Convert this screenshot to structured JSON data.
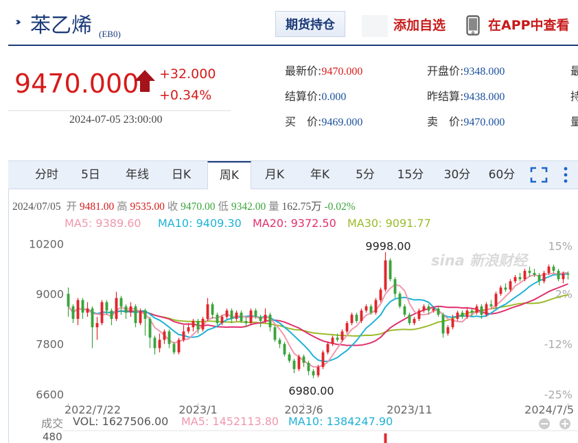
{
  "header": {
    "name": "苯乙烯",
    "code": "(EB0)",
    "holdings_button": "期货持仓",
    "add_watchlist": "添加自选",
    "view_in_app": "在APP中查看"
  },
  "quote": {
    "price": "9470.000",
    "change": "+32.000",
    "change_pct": "+0.34%",
    "datetime": "2024-07-05 23:00:00",
    "fields": [
      {
        "label": "最新价:",
        "value": "9470.000",
        "color": "#d61a1a"
      },
      {
        "label": "开盘价:",
        "value": "9348.000",
        "color": "#1a4f9c"
      },
      {
        "label": "结算价:",
        "value": "0.000",
        "color": "#1a4f9c"
      },
      {
        "label": "昨结算:",
        "value": "9438.000",
        "color": "#1a4f9c"
      },
      {
        "label": "买　价:",
        "value": "9469.000",
        "color": "#1a4f9c"
      },
      {
        "label": "卖　价:",
        "value": "9470.000",
        "color": "#1a4f9c"
      }
    ],
    "cut_labels": [
      "最",
      "持",
      "量"
    ]
  },
  "tabs": {
    "items": [
      "分时",
      "5日",
      "年线",
      "日K",
      "周K",
      "月K",
      "年K",
      "5分",
      "15分",
      "30分",
      "60分"
    ],
    "active_index": 4
  },
  "ohlc_bar": {
    "date": "2024/07/05",
    "open_label": "开",
    "open": "9481.00",
    "high_label": "高",
    "high": "9535.00",
    "close_label": "收",
    "close": "9470.00",
    "low_label": "低",
    "low": "9342.00",
    "vol_label": "量",
    "vol": "162.75万",
    "pct": "-0.02%"
  },
  "ma_legend": {
    "ma5": "MA5: 9389.60",
    "ma10": "MA10: 9409.30",
    "ma20": "MA20: 9372.50",
    "ma30": "MA30: 9091.77"
  },
  "volume_legend": {
    "title": "成交",
    "vol": "VOL: 1627506.00",
    "ma5": "MA5: 1452113.80",
    "ma10": "MA10: 1384247.90",
    "axis_top": "480"
  },
  "watermark": "sina 新浪财经",
  "colors": {
    "up": "#e0262c",
    "down": "#3aa43a",
    "ma5": "#f197ad",
    "ma10": "#1fb1d6",
    "ma20": "#e0306e",
    "ma30": "#9bbb2b",
    "brand": "#1b3a79"
  },
  "chart_data": {
    "type": "candlestick",
    "ylim": [
      6350,
      10500
    ],
    "y_ticks": [
      "10200",
      "9000",
      "7800",
      "6600"
    ],
    "y_tick_values": [
      10200,
      9000,
      7800,
      6600
    ],
    "pct_ticks": [
      "15%",
      "2%",
      "-12%",
      "-25%"
    ],
    "pct_tick_values": [
      10150,
      9000,
      7800,
      6600
    ],
    "x_labels": [
      "2022/7/22",
      "2023/1",
      "2023/6",
      "2023/11",
      "2024/7/5"
    ],
    "x_label_index": [
      0,
      27,
      49,
      71,
      104
    ],
    "annotations": [
      {
        "text": "9998.00",
        "index": 66,
        "value": 9998
      },
      {
        "text": "6980.00",
        "index": 51,
        "value": 6980
      }
    ],
    "candles": [
      [
        9000,
        8700,
        9150,
        8450
      ],
      [
        8700,
        8400,
        8750,
        8300
      ],
      [
        8400,
        8850,
        8900,
        8250
      ],
      [
        8850,
        8550,
        8900,
        8400
      ],
      [
        8550,
        8650,
        8800,
        8450
      ],
      [
        8650,
        8200,
        8700,
        7700
      ],
      [
        8200,
        8300,
        8450,
        7900
      ],
      [
        8300,
        8800,
        8850,
        8250
      ],
      [
        8800,
        8600,
        8850,
        8500
      ],
      [
        8600,
        8400,
        8650,
        8250
      ],
      [
        8400,
        8900,
        9050,
        8350
      ],
      [
        8900,
        8700,
        8950,
        8500
      ],
      [
        8700,
        8550,
        8750,
        8400
      ],
      [
        8550,
        8700,
        8800,
        8450
      ],
      [
        8700,
        8300,
        8750,
        8200
      ],
      [
        8300,
        8600,
        8650,
        8250
      ],
      [
        8600,
        8400,
        8650,
        8000
      ],
      [
        8400,
        7950,
        8450,
        7700
      ],
      [
        7950,
        7700,
        8000,
        7550
      ],
      [
        7700,
        7900,
        8050,
        7600
      ],
      [
        7900,
        8100,
        8150,
        7800
      ],
      [
        8100,
        7800,
        8150,
        7700
      ],
      [
        7800,
        7600,
        7850,
        7550
      ],
      [
        7600,
        7900,
        7950,
        7550
      ],
      [
        7900,
        8100,
        8250,
        7850
      ],
      [
        8100,
        8200,
        8300,
        8050
      ],
      [
        8200,
        8350,
        8400,
        8100
      ],
      [
        8350,
        8150,
        8400,
        8050
      ],
      [
        8150,
        8400,
        8450,
        8100
      ],
      [
        8400,
        8750,
        8900,
        8350
      ],
      [
        8750,
        8500,
        8800,
        8400
      ],
      [
        8500,
        8300,
        8550,
        8250
      ],
      [
        8300,
        8450,
        8500,
        8250
      ],
      [
        8450,
        8600,
        8650,
        8400
      ],
      [
        8600,
        8400,
        8650,
        8300
      ],
      [
        8400,
        8550,
        8600,
        8350
      ],
      [
        8550,
        8350,
        8600,
        8300
      ],
      [
        8350,
        8300,
        8450,
        8200
      ],
      [
        8300,
        8600,
        8650,
        8250
      ],
      [
        8600,
        8450,
        8650,
        8400
      ],
      [
        8450,
        8350,
        8500,
        8200
      ],
      [
        8350,
        8500,
        8650,
        8300
      ],
      [
        8500,
        8200,
        8550,
        8100
      ],
      [
        8200,
        7900,
        8250,
        7850
      ],
      [
        7900,
        7800,
        7950,
        7700
      ],
      [
        7800,
        7550,
        7850,
        7500
      ],
      [
        7550,
        7400,
        7600,
        7350
      ],
      [
        7400,
        7200,
        7450,
        7100
      ],
      [
        7200,
        7500,
        7550,
        7150
      ],
      [
        7500,
        7350,
        7550,
        7250
      ],
      [
        7350,
        7150,
        7400,
        7050
      ],
      [
        7150,
        7050,
        7200,
        6980
      ],
      [
        7050,
        7250,
        7300,
        7000
      ],
      [
        7250,
        7600,
        7650,
        7200
      ],
      [
        7600,
        7800,
        7850,
        7550
      ],
      [
        7800,
        7950,
        8000,
        7750
      ],
      [
        7950,
        7900,
        8050,
        7850
      ],
      [
        7900,
        8100,
        8150,
        7850
      ],
      [
        8100,
        8300,
        8350,
        8050
      ],
      [
        8300,
        8500,
        8550,
        8250
      ],
      [
        8500,
        8350,
        8550,
        8300
      ],
      [
        8350,
        8600,
        8650,
        8300
      ],
      [
        8600,
        8700,
        8750,
        8550
      ],
      [
        8700,
        8550,
        8750,
        8500
      ],
      [
        8550,
        8850,
        8900,
        8500
      ],
      [
        8850,
        9100,
        9150,
        8800
      ],
      [
        9100,
        9800,
        9998,
        9050
      ],
      [
        9800,
        9350,
        9850,
        9300
      ],
      [
        9350,
        9000,
        9400,
        8900
      ],
      [
        9000,
        8700,
        9050,
        8650
      ],
      [
        8700,
        8500,
        8750,
        8450
      ],
      [
        8500,
        8300,
        8550,
        8250
      ],
      [
        8300,
        8400,
        8450,
        8250
      ],
      [
        8400,
        8600,
        8650,
        8350
      ],
      [
        8600,
        8700,
        8750,
        8550
      ],
      [
        8700,
        8600,
        8750,
        8500
      ],
      [
        8600,
        8650,
        8700,
        8550
      ],
      [
        8650,
        8500,
        8700,
        8450
      ],
      [
        8500,
        8050,
        8550,
        7950
      ],
      [
        8050,
        8200,
        8250,
        8000
      ],
      [
        8200,
        8400,
        8500,
        8150
      ],
      [
        8400,
        8550,
        8600,
        8350
      ],
      [
        8550,
        8450,
        8600,
        8400
      ],
      [
        8450,
        8600,
        8650,
        8400
      ],
      [
        8600,
        8550,
        8650,
        8450
      ],
      [
        8550,
        8700,
        8750,
        8500
      ],
      [
        8700,
        8500,
        8750,
        8400
      ],
      [
        8500,
        8750,
        8800,
        8450
      ],
      [
        8750,
        8700,
        8850,
        8650
      ],
      [
        8700,
        9000,
        9050,
        8650
      ],
      [
        9000,
        9150,
        9200,
        8950
      ],
      [
        9150,
        9100,
        9250,
        9050
      ],
      [
        9100,
        9300,
        9350,
        9050
      ],
      [
        9300,
        9400,
        9450,
        9250
      ],
      [
        9400,
        9350,
        9500,
        9300
      ],
      [
        9350,
        9550,
        9600,
        9300
      ],
      [
        9550,
        9500,
        9650,
        9400
      ],
      [
        9500,
        9450,
        9600,
        9400
      ],
      [
        9450,
        9300,
        9500,
        9200
      ],
      [
        9300,
        9500,
        9550,
        9250
      ],
      [
        9500,
        9650,
        9700,
        9450
      ],
      [
        9650,
        9550,
        9700,
        9500
      ],
      [
        9550,
        9350,
        9600,
        9300
      ],
      [
        9350,
        9480,
        9535,
        9250
      ],
      [
        9481,
        9470,
        9535,
        9342
      ]
    ]
  }
}
